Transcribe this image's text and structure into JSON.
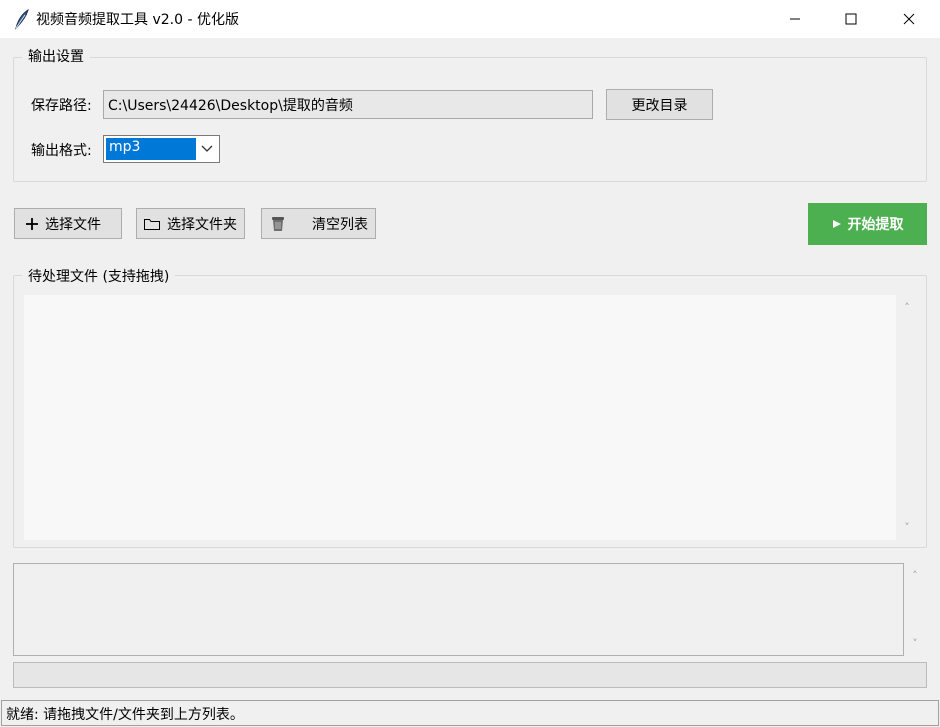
{
  "window": {
    "title": "视频音频提取工具 v2.0 - 优化版",
    "icon": "feather-icon",
    "controls": [
      "minimize-icon",
      "maximize-icon",
      "close-icon"
    ]
  },
  "output_settings": {
    "legend": "输出设置",
    "path_label": "保存路径:",
    "path_value": "C:\\Users\\24426\\Desktop\\提取的音频",
    "change_dir_label": "更改目录",
    "format_label": "输出格式:",
    "format_value": "mp3"
  },
  "toolbar": {
    "add_file_label": "选择文件",
    "add_folder_label": "选择文件夹",
    "clear_label": "清空列表",
    "start_label": "开始提取",
    "start_color": "#4caf50"
  },
  "file_list": {
    "legend": "待处理文件 (支持拖拽)",
    "items": []
  },
  "log": {
    "lines": []
  },
  "progress": {
    "value": 0
  },
  "status": {
    "text": "就绪: 请拖拽文件/文件夹到上方列表。"
  }
}
